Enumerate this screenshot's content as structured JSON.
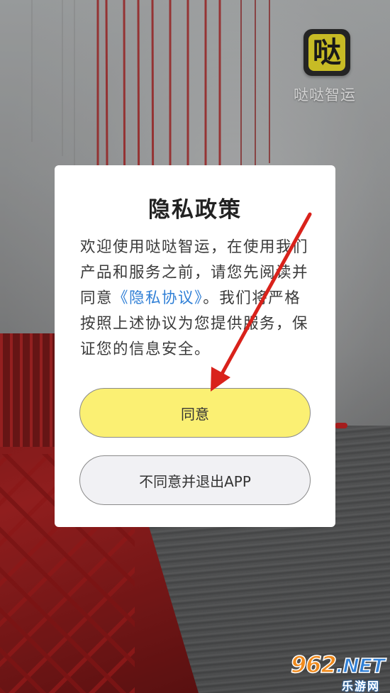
{
  "app": {
    "logo_glyph": "哒",
    "name": "哒哒智运"
  },
  "dialog": {
    "title": "隐私政策",
    "body_before": "欢迎使用哒哒智运，在使用我们产品和服务之前，请您先阅读并同意",
    "link_text": "《隐私协议》",
    "body_after": "。我们将严格按照上述协议为您提供服务，保证您的信息安全。",
    "agree_label": "同意",
    "decline_label": "不同意并退出APP"
  },
  "watermark": {
    "main_number": "962",
    "main_suffix": ".NET",
    "sub": "乐游网"
  },
  "colors": {
    "agree_button": "#fbf073",
    "decline_button": "#f1f1f4",
    "link": "#2f7fd6",
    "annotation_arrow": "#d9221b",
    "logo_yellow": "#f3e52e"
  }
}
